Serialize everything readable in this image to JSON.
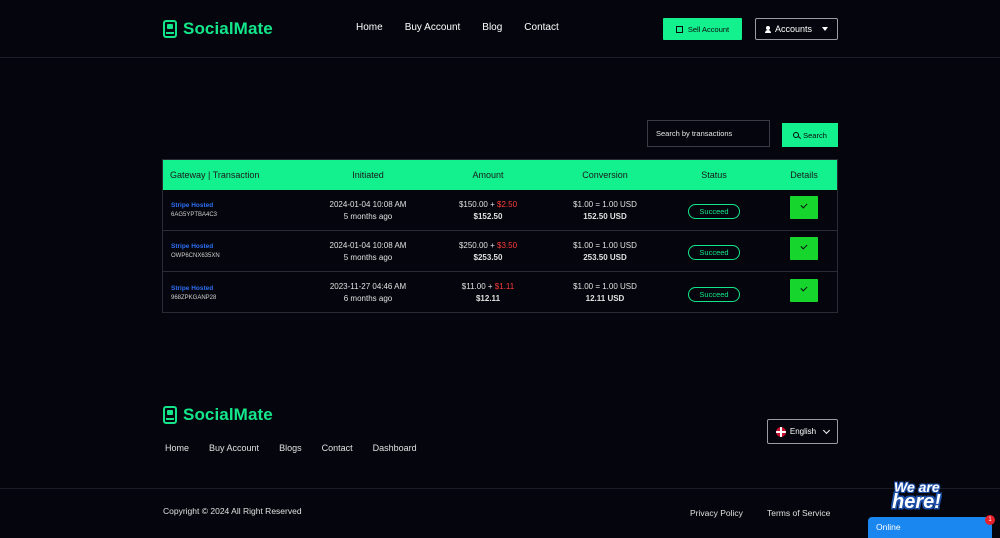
{
  "header": {
    "brand": "SocialMate",
    "nav": [
      "Home",
      "Buy Account",
      "Blog",
      "Contact"
    ],
    "sell_label": "Sell Account",
    "accounts_label": "Accounts"
  },
  "search": {
    "placeholder": "Search by transactions",
    "button_label": "Search"
  },
  "table": {
    "headers": [
      "Gateway | Transaction",
      "Initiated",
      "Amount",
      "Conversion",
      "Status",
      "Details"
    ],
    "rows": [
      {
        "gateway": "Stripe Hosted",
        "trx": "6AG5YPTBA4C3",
        "date": "2024-01-04 10:08 AM",
        "ago": "5 months ago",
        "amount": "$150.00",
        "charge": "$2.50",
        "total": "$152.50",
        "rate": "$1.00 = 1.00 USD",
        "converted": "152.50 USD",
        "status": "Succeed"
      },
      {
        "gateway": "Stripe Hosted",
        "trx": "OWP6CNX635XN",
        "date": "2024-01-04 10:08 AM",
        "ago": "5 months ago",
        "amount": "$250.00",
        "charge": "$3.50",
        "total": "$253.50",
        "rate": "$1.00 = 1.00 USD",
        "converted": "253.50 USD",
        "status": "Succeed"
      },
      {
        "gateway": "Stripe Hosted",
        "trx": "968ZPKGANP28",
        "date": "2023-11-27 04:46 AM",
        "ago": "6 months ago",
        "amount": "$11.00",
        "charge": "$1.11",
        "total": "$12.11",
        "rate": "$1.00 = 1.00 USD",
        "converted": "12.11 USD",
        "status": "Succeed"
      }
    ]
  },
  "footer": {
    "brand": "SocialMate",
    "nav": [
      "Home",
      "Buy Account",
      "Blogs",
      "Contact",
      "Dashboard"
    ],
    "language": "English",
    "copyright": "Copyright © 2024 All Right Reserved",
    "privacy": "Privacy Policy",
    "terms": "Terms of Service"
  },
  "chat": {
    "title_line1": "We are",
    "title_line2": "here!",
    "status": "Online",
    "badge_count": "1"
  },
  "colors": {
    "accent": "#13f08e",
    "background": "#05060d",
    "link_blue": "#2d6ff5",
    "charge_red": "#ff3b3b",
    "detail_green": "#16d62d"
  }
}
